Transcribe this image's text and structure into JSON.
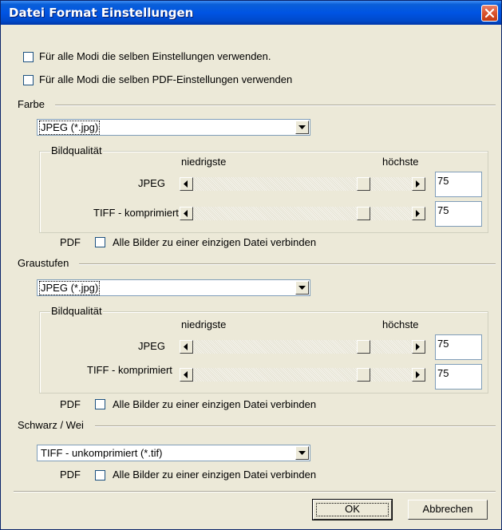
{
  "window": {
    "title": "Datei Format Einstellungen"
  },
  "options": {
    "same_settings": "Für alle Modi die selben Einstellungen verwenden.",
    "same_pdf_settings": "Für alle Modi die selben PDF-Einstellungen verwenden"
  },
  "color": {
    "heading": "Farbe",
    "format": "JPEG (*.jpg)",
    "group_label": "Bildqualität",
    "low_label": "niedrigste",
    "high_label": "höchste",
    "jpeg_label": "JPEG",
    "jpeg_value": "75",
    "tiff_label": "TIFF - komprimiert",
    "tiff_value": "75",
    "pdf_label": "PDF",
    "pdf_option": "Alle Bilder zu einer einzigen Datei verbinden"
  },
  "gray": {
    "heading": "Graustufen",
    "format": "JPEG (*.jpg)",
    "group_label": "Bildqualität",
    "low_label": "niedrigste",
    "high_label": "höchste",
    "jpeg_label": "JPEG",
    "jpeg_value": "75",
    "tiff_label": "TIFF - komprimiert",
    "tiff_value": "75",
    "pdf_label": "PDF",
    "pdf_option": "Alle Bilder zu einer einzigen Datei verbinden"
  },
  "bw": {
    "heading": "Schwarz / Wei",
    "format": "TIFF - unkomprimiert (*.tif)",
    "pdf_label": "PDF",
    "pdf_option": "Alle Bilder zu einer einzigen Datei verbinden"
  },
  "buttons": {
    "ok": "OK",
    "cancel": "Abbrechen"
  },
  "icons": {
    "close": "close-icon",
    "dropdown": "chevron-down-icon",
    "left": "arrow-left-icon",
    "right": "arrow-right-icon"
  },
  "colors": {
    "titlebar": "#0054e3",
    "dialog_bg": "#ece9d8",
    "close": "#d9542e"
  }
}
